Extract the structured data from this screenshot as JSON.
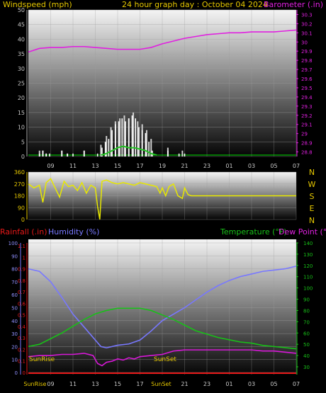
{
  "header": {
    "left_label": "Windspeed (mph)",
    "center_label": "24 hour graph day : October 04 2024",
    "right_label": "Barometer (.in)"
  },
  "colors": {
    "wind": "#ffffff",
    "gust": "#d0d0d0",
    "wind_avg": "#22c222",
    "barometer": "#e020e0",
    "direction": "#e8e800",
    "humidity": "#7878ff",
    "temperature": "#18c018",
    "dewpoint": "#d818d8",
    "rainfall": "#e81818",
    "label_yellow": "#e6c800",
    "label_magenta": "#e020e0",
    "label_green": "#18c018",
    "label_blue": "#7878ff",
    "label_red": "#e81818",
    "zero_line": "#00e000"
  },
  "x_axis": {
    "hour_labels": [
      "09",
      "11",
      "13",
      "15",
      "17",
      "19",
      "21",
      "23",
      "01",
      "03",
      "05",
      "07"
    ],
    "bottom_labels": [
      "SunRise",
      "09",
      "11",
      "13",
      "15",
      "17",
      "SunSet",
      "21",
      "23",
      "01",
      "03",
      "05",
      "07"
    ]
  },
  "chart_data": [
    {
      "id": "wind_baro",
      "type": "bar",
      "title": "24 hour graph day : October 04 2024",
      "y_left_label": "Windspeed (mph)",
      "y_right_label": "Barometer (.in)",
      "y_left_ticks": [
        0,
        5,
        10,
        15,
        20,
        25,
        30,
        35,
        40,
        45,
        50
      ],
      "y_left_range": [
        0,
        50
      ],
      "y_right_ticks": [
        "28.8",
        "28.9",
        "29",
        "29.1",
        "29.2",
        "29.3",
        "29.4",
        "29.5",
        "29.6",
        "29.7",
        "29.8",
        "29.9",
        "30",
        "30.1",
        "30.2",
        "30.3"
      ],
      "y_right_range": [
        28.75,
        30.35
      ],
      "hours_range": [
        7,
        31
      ],
      "wind_speed": {
        "x": [
          8.0,
          8.3,
          8.6,
          8.9,
          10.0,
          10.5,
          11.0,
          12.0,
          13.2,
          13.6,
          13.9,
          14.2,
          14.5,
          14.8,
          15.1,
          15.4,
          15.7,
          16.0,
          16.3,
          16.6,
          16.9,
          17.2,
          17.5,
          17.8,
          18.1,
          19.5,
          20.5,
          21.0
        ],
        "values": [
          1,
          2,
          1,
          1,
          2,
          1,
          1,
          2,
          1,
          3,
          5,
          6,
          9,
          11,
          12,
          13,
          12,
          13,
          14,
          13,
          10,
          9,
          8,
          5,
          2,
          2,
          1,
          1
        ]
      },
      "wind_gust": {
        "x": [
          8.0,
          8.3,
          8.6,
          10.0,
          10.5,
          12.0,
          13.5,
          14.0,
          14.4,
          14.8,
          15.2,
          15.6,
          16.0,
          16.4,
          16.8,
          17.2,
          17.6,
          18.0,
          19.5,
          20.8
        ],
        "values": [
          2,
          2,
          1,
          2,
          1,
          2,
          4,
          7,
          10,
          12,
          13,
          14,
          13,
          15,
          12,
          11,
          9,
          6,
          3,
          2
        ]
      },
      "wind_avg": {
        "x": [
          13.5,
          14.0,
          14.5,
          15.0,
          15.5,
          16.0,
          16.5,
          17.0,
          17.5,
          18.0,
          18.5
        ],
        "values": [
          0.5,
          1,
          2,
          3,
          3.5,
          3,
          3,
          2.5,
          2,
          1,
          0.5
        ]
      },
      "barometer": {
        "x": [
          7.0,
          8.0,
          9.0,
          10.0,
          11.0,
          12.0,
          13.0,
          14.0,
          15.0,
          16.0,
          17.0,
          18.0,
          19.0,
          20.0,
          21.0,
          22.0,
          23.0,
          24.0,
          25.0,
          26.0,
          27.0,
          28.0,
          29.0,
          30.0,
          31.0
        ],
        "values": [
          29.89,
          29.93,
          29.94,
          29.94,
          29.95,
          29.95,
          29.94,
          29.93,
          29.92,
          29.92,
          29.92,
          29.94,
          29.98,
          30.01,
          30.04,
          30.06,
          30.08,
          30.09,
          30.1,
          30.1,
          30.11,
          30.11,
          30.11,
          30.12,
          30.13
        ]
      }
    },
    {
      "id": "direction",
      "type": "line",
      "y_ticks": [
        0,
        90,
        180,
        270,
        360
      ],
      "y_range": [
        0,
        360
      ],
      "compass_labels": [
        "N",
        "W",
        "S",
        "E",
        "N"
      ],
      "hours_range": [
        7,
        31
      ],
      "series": [
        {
          "x": [
            7.0,
            7.5,
            8.0,
            8.3,
            8.6,
            9.0,
            9.4,
            9.8,
            10.2,
            10.6,
            11.0,
            11.4,
            11.8,
            12.2,
            12.6,
            13.0,
            13.2,
            13.4,
            13.6,
            14.0,
            14.5,
            15.0,
            15.5,
            16.0,
            16.5,
            17.0,
            17.5,
            18.0,
            18.5,
            18.8,
            19.0,
            19.3,
            19.6,
            20.0,
            20.4,
            20.8,
            21.0,
            21.3,
            21.6,
            22.0,
            24.0,
            26.0,
            28.0,
            30.0,
            31.0
          ],
          "values": [
            270,
            240,
            260,
            130,
            280,
            310,
            240,
            170,
            290,
            250,
            260,
            220,
            280,
            200,
            260,
            240,
            100,
            0,
            290,
            300,
            280,
            270,
            280,
            270,
            260,
            280,
            270,
            260,
            250,
            200,
            240,
            180,
            250,
            270,
            180,
            160,
            240,
            190,
            180,
            180,
            180,
            180,
            180,
            180,
            180
          ]
        }
      ]
    },
    {
      "id": "temp_hum",
      "type": "line",
      "y_left_outer_label": "Rainfall (.in)",
      "y_left_inner_label": "Humidity (%)",
      "y_right_label_1": "Temperature (°F)",
      "y_right_label_2": "Dew Point (°F)",
      "rain_ticks": [
        "0",
        "0.1",
        "0.2",
        "0.3",
        "0.4",
        "0.5",
        "0.6",
        "0.7",
        "0.8",
        "0.9",
        "1",
        "1.1"
      ],
      "humidity_ticks": [
        0,
        10,
        20,
        30,
        40,
        50,
        60,
        70,
        80,
        90,
        100
      ],
      "temp_ticks": [
        30,
        40,
        50,
        60,
        70,
        80,
        90,
        100,
        110,
        120,
        130,
        140
      ],
      "hours_range": [
        7,
        31
      ],
      "humidity": {
        "x": [
          7.0,
          8.0,
          9.0,
          10.0,
          11.0,
          12.0,
          13.0,
          13.5,
          14.0,
          15.0,
          16.0,
          17.0,
          18.0,
          19.0,
          20.0,
          21.0,
          22.0,
          23.0,
          24.0,
          25.0,
          26.0,
          27.0,
          28.0,
          29.0,
          30.0,
          31.0
        ],
        "values": [
          80,
          78,
          70,
          58,
          45,
          35,
          25,
          20,
          19,
          21,
          22,
          25,
          32,
          40,
          45,
          50,
          56,
          62,
          67,
          71,
          74,
          76,
          78,
          79,
          80,
          82
        ]
      },
      "temperature": {
        "x": [
          7.0,
          8.0,
          9.0,
          10.0,
          11.0,
          12.0,
          13.0,
          14.0,
          15.0,
          16.0,
          17.0,
          18.0,
          19.0,
          20.0,
          21.0,
          22.0,
          23.0,
          24.0,
          25.0,
          26.0,
          27.0,
          28.0,
          29.0,
          30.0,
          31.0
        ],
        "values": [
          48,
          50,
          55,
          60,
          66,
          72,
          77,
          80,
          82,
          82,
          82,
          80,
          76,
          72,
          67,
          62,
          59,
          56,
          54,
          52,
          51,
          49,
          48,
          47,
          46
        ]
      },
      "dewpoint": {
        "x": [
          7.0,
          8.0,
          9.0,
          10.0,
          11.0,
          12.0,
          12.8,
          13.2,
          13.6,
          14.0,
          14.5,
          15.0,
          15.5,
          16.0,
          16.5,
          17.0,
          18.0,
          19.0,
          20.0,
          21.0,
          22.0,
          23.0,
          24.0,
          25.0,
          26.0,
          27.0,
          28.0,
          29.0,
          30.0,
          31.0
        ],
        "values": [
          39,
          40,
          40,
          41,
          41,
          42,
          40,
          33,
          31,
          34,
          35,
          37,
          36,
          38,
          37,
          39,
          40,
          41,
          44,
          45,
          45,
          45,
          45,
          45,
          45,
          45,
          44,
          44,
          43,
          42
        ]
      },
      "rainfall": {
        "x": [
          7.0,
          31.0
        ],
        "values": [
          0,
          0
        ]
      },
      "sun_labels": {
        "sunrise": "SunRise",
        "sunset": "SunSet"
      }
    }
  ]
}
